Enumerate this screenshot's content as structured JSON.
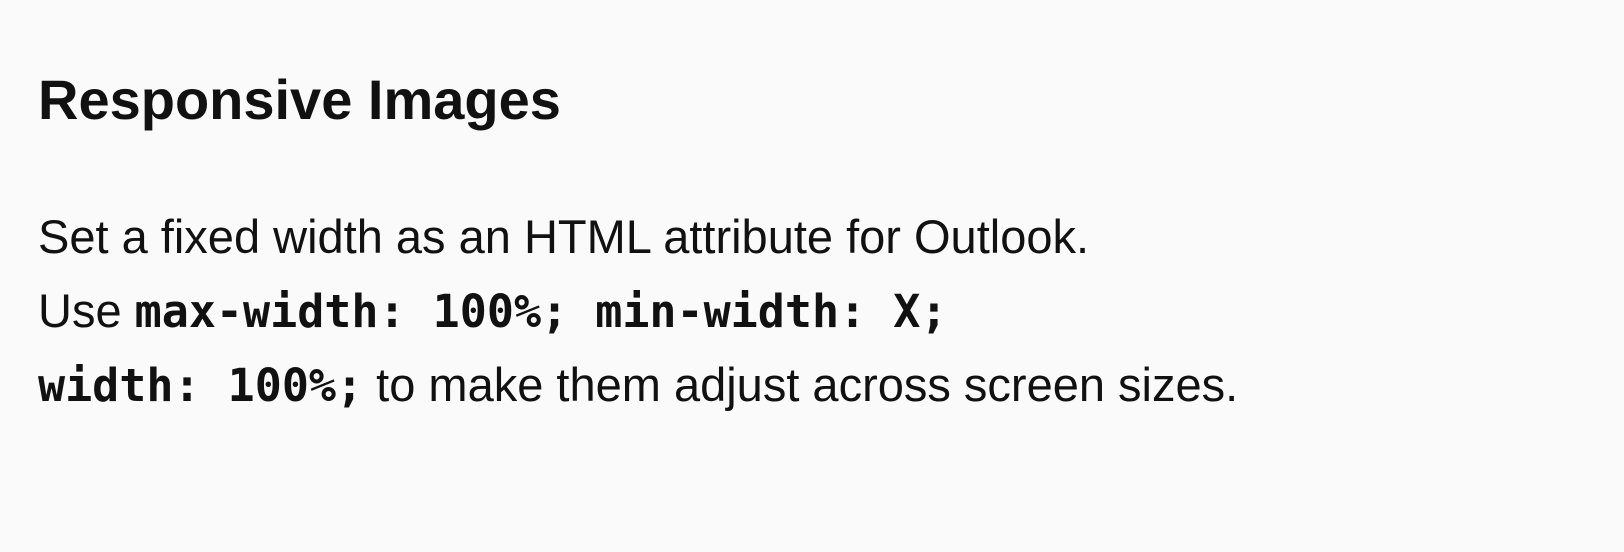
{
  "slide": {
    "title": "Responsive Images",
    "line1": {
      "text": "Set a fixed width as an HTML attribute for Outlook."
    },
    "line2": {
      "prefix": "Use",
      "code": "max-width: 100%; min-width: X;"
    },
    "line3": {
      "code": "width: 100%;",
      "suffix": "to make them adjust across screen sizes."
    }
  }
}
